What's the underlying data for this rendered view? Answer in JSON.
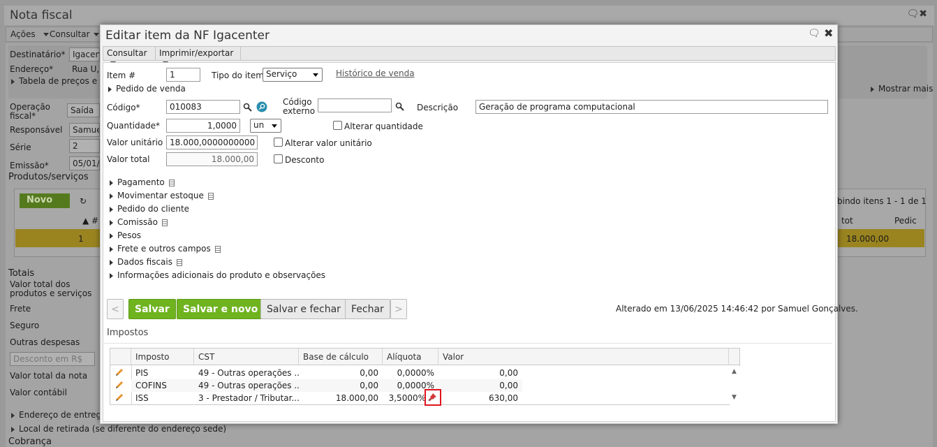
{
  "background": {
    "title": "Nota fiscal",
    "menu": [
      "Ações",
      "Consultar"
    ],
    "labels": [
      "Destinatário*",
      "Endereço*",
      "Tabela de preços e r",
      "Operação fiscal*",
      "Responsável",
      "Série",
      "Emissão*",
      "Produtos/serviços",
      "Totais",
      "Valor total dos produtos e serviços",
      "Frete",
      "Seguro",
      "Outras despesas",
      "Valor total da nota",
      "Valor contábil",
      "Endereço de entrega",
      "Local de retirada (se diferente do endereço sede)",
      "Cobrança"
    ],
    "inputs": [
      "Igacent",
      "Rua U,",
      "Saída",
      "Samuel",
      "2",
      "05/01/2"
    ],
    "desconto_select": "Desconto em R$",
    "mostrar_mais": "Mostrar mais",
    "novo_label": "Novo",
    "grid_info": "bindo itens 1 - 1 de 1",
    "grid_headers": [
      "#",
      "tot",
      "Pedic"
    ],
    "grid_row": {
      "num": "1",
      "total": "18.000,00"
    }
  },
  "modal": {
    "title": "Editar item da NF Igacenter",
    "menu": [
      "Consultar",
      "Imprimir/exportar"
    ],
    "item_label": "Item #",
    "item_value": "1",
    "tipo_label": "Tipo do item",
    "tipo_value": "Serviço",
    "historico_link": "Histórico de venda",
    "pedido_venda": "Pedido de venda",
    "codigo_label": "Código*",
    "codigo_value": "010083",
    "codigo_externo_label": "Código externo",
    "codigo_externo_value": "",
    "descricao_label": "Descrição",
    "descricao_value": "Geração de programa computacional",
    "quantidade_label": "Quantidade*",
    "quantidade_value": "1,0000",
    "unidade": "un",
    "alterar_quantidade": "Alterar quantidade",
    "valor_unitario_label": "Valor unitário",
    "valor_unitario_value": "18.000,0000000000",
    "alterar_valor_unitario": "Alterar valor unitário",
    "valor_total_label": "Valor total",
    "valor_total_value": "18.000,00",
    "desconto": "Desconto",
    "sections": [
      "Pagamento",
      "Movimentar estoque",
      "Pedido do cliente",
      "Comissão",
      "Pesos",
      "Frete e outros campos",
      "Dados fiscais",
      "Informações adicionais do produto e observações"
    ],
    "buttons": {
      "prev": "<",
      "salvar": "Salvar",
      "salvar_novo": "Salvar e novo",
      "salvar_fechar": "Salvar e fechar",
      "fechar": "Fechar",
      "next": ">"
    },
    "status": "Alterado em 13/06/2025 14:46:42 por Samuel Gonçalves.",
    "impostos_title": "Impostos",
    "impostos_headers": [
      "Imposto",
      "CST",
      "Base de cálculo",
      "Alíquota",
      "Valor"
    ],
    "impostos_rows": [
      {
        "imposto": "PIS",
        "cst": "49 - Outras operações ...",
        "base": "0,00",
        "aliquota": "0,0000%",
        "valor": "0,00"
      },
      {
        "imposto": "COFINS",
        "cst": "49 - Outras operações ...",
        "base": "0,00",
        "aliquota": "0,0000%",
        "valor": "0,00"
      },
      {
        "imposto": "ISS",
        "cst": "3 - Prestador / Tributar...",
        "base": "18.000,00",
        "aliquota": "3,5000%",
        "valor": "630,00"
      }
    ]
  },
  "colors": {
    "green": "#6fb31f",
    "highlight": "#e0141e",
    "overlay": "#9a9a9a"
  }
}
